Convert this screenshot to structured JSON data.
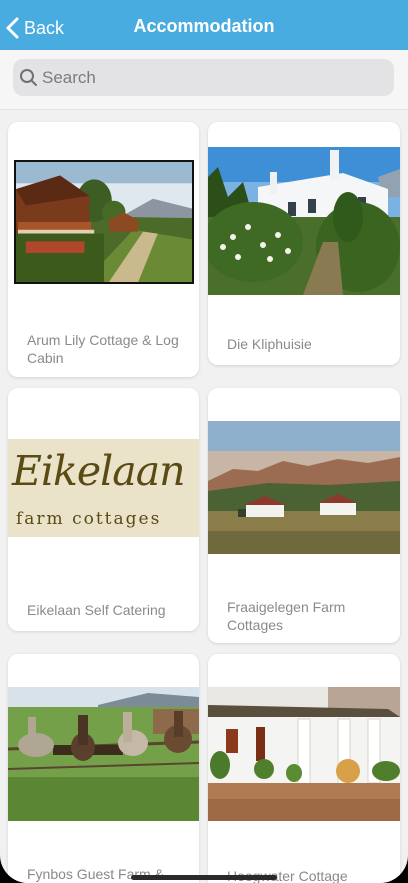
{
  "nav": {
    "back_label": "Back",
    "title": "Accommodation"
  },
  "search": {
    "placeholder": "Search",
    "value": ""
  },
  "listings": [
    {
      "label": "Arum Lily Cottage & Log Cabin"
    },
    {
      "label": "Die Kliphuisie"
    },
    {
      "label": "Eikelaan Self Catering",
      "logo_title": "Eikelaan",
      "logo_subtitle": "farm cottages"
    },
    {
      "label": "Fraaigelegen Farm Cottages"
    },
    {
      "label": "Fynbos Guest Farm &"
    },
    {
      "label": "Hoogwater Cottage"
    }
  ],
  "colors": {
    "nav_bar": "#49ace0",
    "background": "#f1f1f1",
    "card": "#ffffff",
    "label_text": "#8a8a8a"
  }
}
